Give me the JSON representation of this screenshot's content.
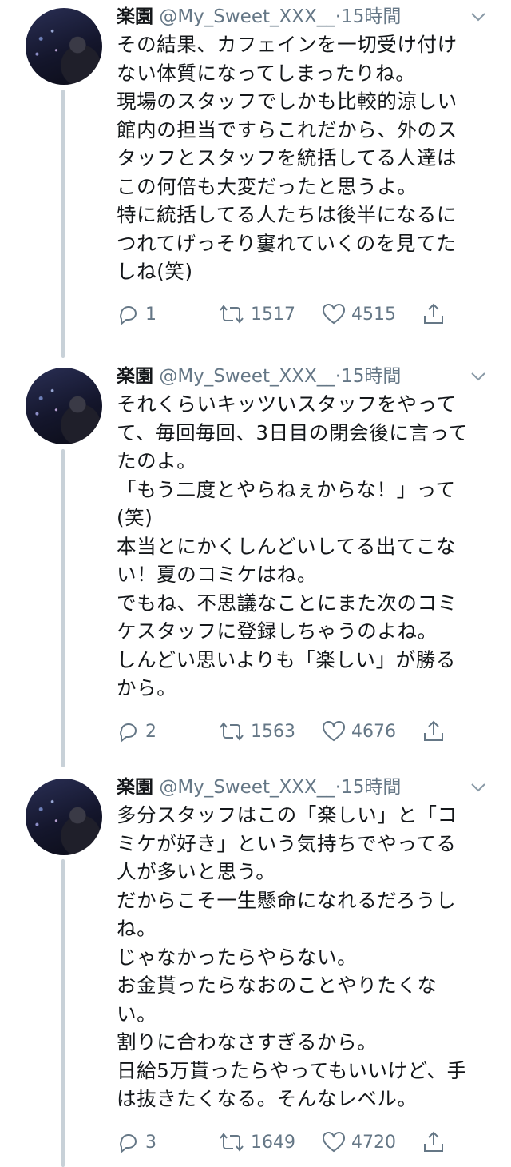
{
  "tweets": [
    {
      "name": "楽園",
      "handle": "@My_Sweet_XXX__",
      "dot": "·",
      "time": "15時間",
      "lines": [
        "その結果、カフェインを一切受け付け",
        "ない体質になってしまったりね。",
        "現場のスタッフでしかも比較的涼しい",
        "館内の担当ですらこれだから、外のス",
        "タッフとスタッフを統括してる人達は",
        "この何倍も大変だったと思うよ。",
        "特に統括してる人たちは後半になるに",
        "つれてげっそり窶れていくのを見てた",
        "しね(笑)"
      ],
      "replies": "1",
      "retweets": "1517",
      "likes": "4515"
    },
    {
      "name": "楽園",
      "handle": "@My_Sweet_XXX__",
      "dot": "·",
      "time": "15時間",
      "lines": [
        "それくらいキッツいスタッフをやって",
        "て、毎回毎回、3日目の閉会後に言って",
        "たのよ。",
        "「もう二度とやらねぇからな！」って",
        "(笑)",
        "本当とにかくしんどいしてる出てこな",
        "い！夏のコミケはね。",
        "でもね、不思議なことにまた次のコミ",
        "ケスタッフに登録しちゃうのよね。",
        "しんどい思いよりも「楽しい」が勝る",
        "から。"
      ],
      "replies": "2",
      "retweets": "1563",
      "likes": "4676"
    },
    {
      "name": "楽園",
      "handle": "@My_Sweet_XXX__",
      "dot": "·",
      "time": "15時間",
      "lines": [
        "多分スタッフはこの「楽しい」と「コ",
        "ミケが好き」という気持ちでやってる",
        "人が多いと思う。",
        "だからこそ一生懸命になれるだろうし",
        "ね。",
        "じゃなかったらやらない。",
        "お金貰ったらなおのことやりたくな",
        "い。",
        "割りに合わなさすぎるから。",
        "日給5万貰ったらやってもいいけど、手",
        "は抜きたくなる。そんなレベル。"
      ],
      "replies": "3",
      "retweets": "1649",
      "likes": "4720"
    }
  ],
  "icons": {
    "reply": "reply-icon",
    "retweet": "retweet-icon",
    "like": "heart-icon",
    "share": "share-icon",
    "menu": "chevron-down-icon"
  },
  "colors": {
    "thread_line": "#c8d1d8",
    "secondary_text": "#657786"
  }
}
